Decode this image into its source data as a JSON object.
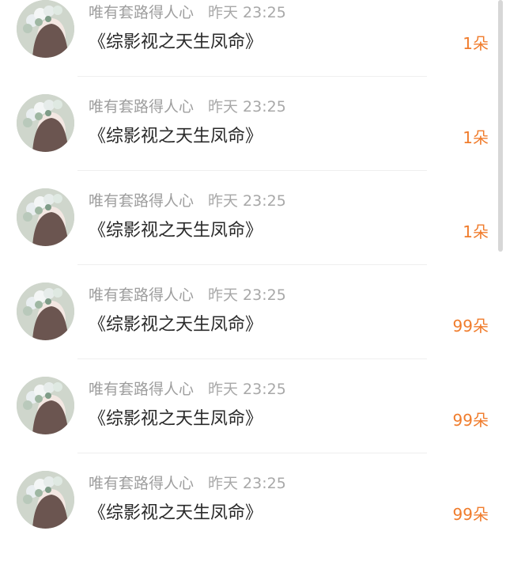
{
  "colors": {
    "username": "#9e9e9e",
    "title": "#2a2a2a",
    "gift_count": "#f07c2c",
    "divider": "#efefef"
  },
  "list": {
    "items": [
      {
        "username": "唯有套路得人心",
        "time": "昨天 23:25",
        "title": "《综影视之天生凤命》",
        "gift": "1朵",
        "avatar_icon": "flower-crown-avatar"
      },
      {
        "username": "唯有套路得人心",
        "time": "昨天 23:25",
        "title": "《综影视之天生凤命》",
        "gift": "1朵",
        "avatar_icon": "flower-crown-avatar"
      },
      {
        "username": "唯有套路得人心",
        "time": "昨天 23:25",
        "title": "《综影视之天生凤命》",
        "gift": "1朵",
        "avatar_icon": "flower-crown-avatar"
      },
      {
        "username": "唯有套路得人心",
        "time": "昨天 23:25",
        "title": "《综影视之天生凤命》",
        "gift": "99朵",
        "avatar_icon": "flower-crown-avatar"
      },
      {
        "username": "唯有套路得人心",
        "time": "昨天 23:25",
        "title": "《综影视之天生凤命》",
        "gift": "99朵",
        "avatar_icon": "flower-crown-avatar"
      },
      {
        "username": "唯有套路得人心",
        "time": "昨天 23:25",
        "title": "《综影视之天生凤命》",
        "gift": "99朵",
        "avatar_icon": "flower-crown-avatar"
      }
    ]
  }
}
